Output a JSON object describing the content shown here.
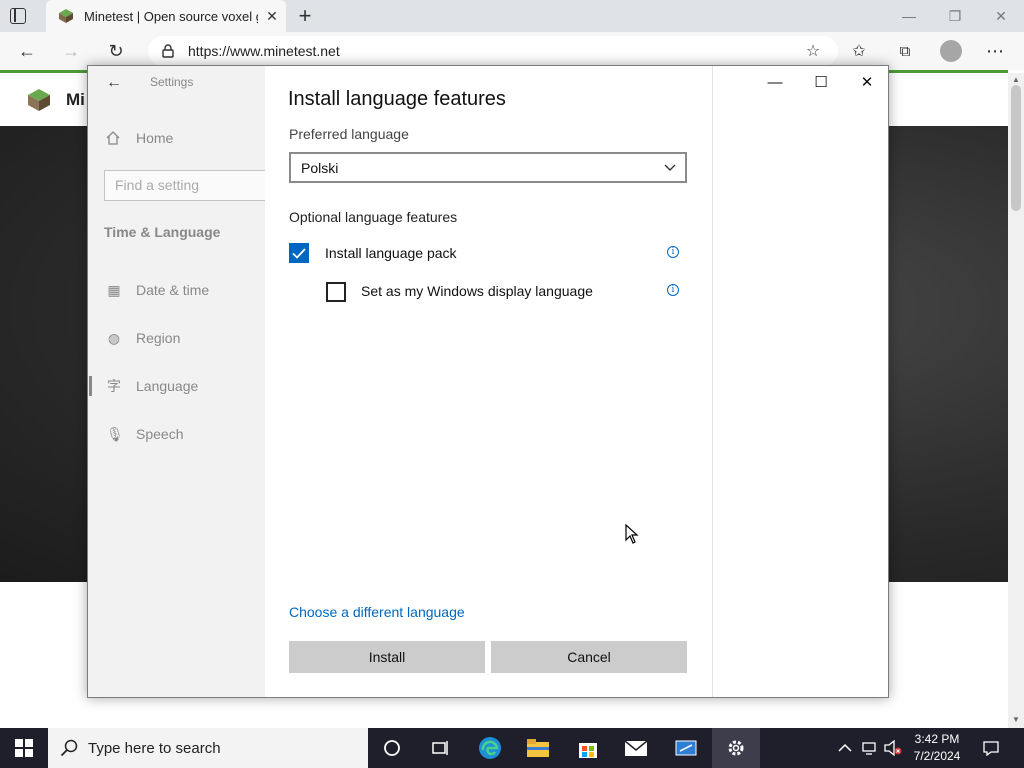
{
  "browser": {
    "tab_title": "Minetest | Open source voxel ga",
    "url": "https://www.minetest.net",
    "accent_color": "#4e9a37"
  },
  "website": {
    "title_fragment": "Mi"
  },
  "settings": {
    "app_title": "Settings",
    "home_label": "Home",
    "search_placeholder": "Find a setting",
    "section_title": "Time & Language",
    "nav": [
      {
        "label": "Date & time",
        "icon": "calendar-clock-icon"
      },
      {
        "label": "Region",
        "icon": "globe-icon"
      },
      {
        "label": "Language",
        "icon": "language-icon",
        "selected": true
      },
      {
        "label": "Speech",
        "icon": "microphone-icon"
      }
    ]
  },
  "dialog": {
    "title": "Install language features",
    "preferred_label": "Preferred language",
    "preferred_value": "Polski",
    "optional_label": "Optional language features",
    "install_pack_label": "Install language pack",
    "install_pack_checked": true,
    "display_language_label": "Set as my Windows display language",
    "display_language_checked": false,
    "choose_link": "Choose a different language",
    "install_button": "Install",
    "cancel_button": "Cancel",
    "accent_color": "#0067c0"
  },
  "taskbar": {
    "search_placeholder": "Type here to search",
    "time": "3:42 PM",
    "date": "7/2/2024"
  }
}
